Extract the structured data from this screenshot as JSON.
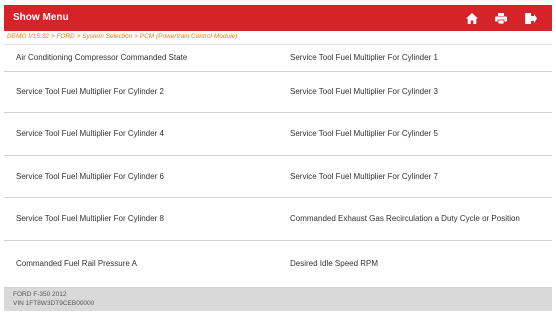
{
  "header": {
    "title": "Show Menu",
    "icons": [
      "home-icon",
      "print-icon",
      "exit-icon"
    ],
    "bar_color": "#d6232a"
  },
  "breadcrumb": {
    "text": "DEMO V15.32 > FORD > System Selection > PCM (Powertrain Control Module)",
    "color": "#ea7d17"
  },
  "items": [
    [
      "Air Conditioning Compressor Commanded State",
      "Service Tool Fuel Multiplier For Cylinder 1"
    ],
    [
      "Service Tool Fuel Multiplier For Cylinder 2",
      "Service Tool Fuel Multiplier For Cylinder 3"
    ],
    [
      "Service Tool Fuel Multiplier For Cylinder 4",
      "Service Tool Fuel Multiplier For Cylinder 5"
    ],
    [
      "Service Tool Fuel Multiplier For Cylinder 6",
      "Service Tool Fuel Multiplier For Cylinder 7"
    ],
    [
      "Service Tool Fuel Multiplier For Cylinder 8",
      "Commanded Exhaust Gas Recirculation a Duty Cycle or Position"
    ],
    [
      "Commanded Fuel Rail Pressure A",
      "Desired Idle Speed RPM"
    ]
  ],
  "footer": {
    "vehicle": "FORD F-350 2012",
    "vin": "VIN 1FT8W3DT9CEB00000"
  }
}
